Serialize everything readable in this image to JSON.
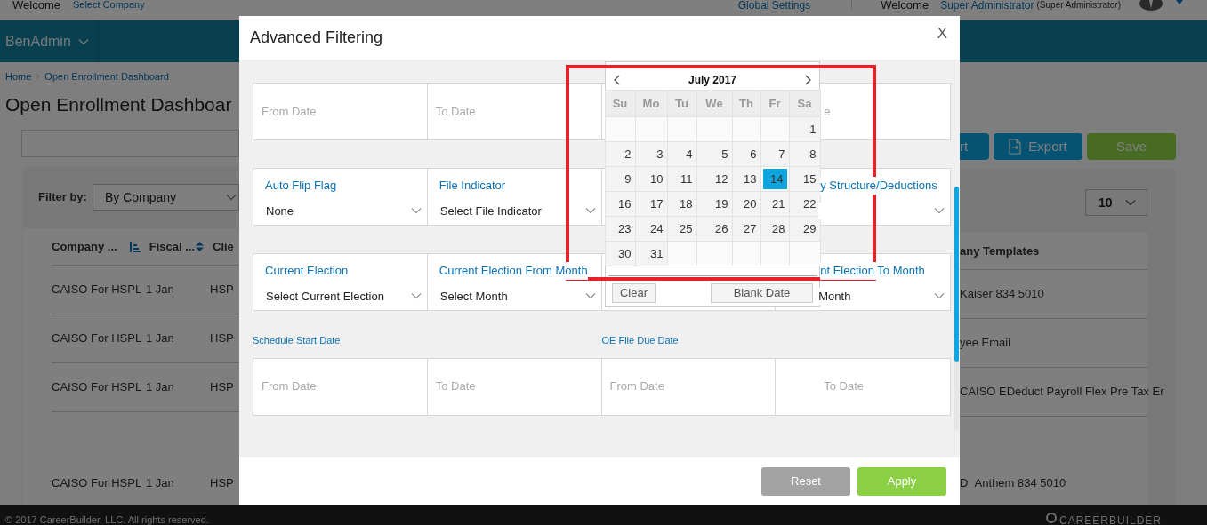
{
  "header": {
    "welcome": "Welcome",
    "company_link": "Select Company",
    "global_settings": "Global Settings",
    "user_welcome": "Welcome",
    "user_name": "Super Administrator",
    "user_role": "(Super Administrator)"
  },
  "nav": {
    "app_menu": "BenAdmin"
  },
  "breadcrumb": [
    "Home",
    "Open Enrollment Dashboard"
  ],
  "page_title": "Open Enrollment Dashboar",
  "toolbar_buttons": [
    {
      "label": "rt",
      "kind": "import"
    },
    {
      "label": "Export",
      "kind": "export"
    },
    {
      "label": "Save",
      "kind": "save"
    }
  ],
  "filter": {
    "label": "Filter by:",
    "value": "By Company"
  },
  "page_size": "10",
  "table": {
    "columns": [
      {
        "label": "Company ...",
        "kind": "list-sort"
      },
      {
        "label": "Fiscal ...",
        "kind": "updown-sort"
      },
      {
        "label": "Clie",
        "kind": "plain"
      },
      {
        "label": "any Templates",
        "kind": "plain"
      }
    ],
    "rows": [
      [
        "CAISO For HSPL",
        "1 Jan",
        "HSP",
        "Kaiser 834 5010"
      ],
      [
        "CAISO For HSPL",
        "1 Jan",
        "HSP",
        "yee Email"
      ],
      [
        "CAISO For HSPL",
        "1 Jan",
        "HSP",
        "CAISO EDeduct Payroll Flex Pre Tax Er"
      ],
      [
        "CAISO For HSPL",
        "1 Jan",
        "HSP",
        "D_Anthem 834 5010"
      ]
    ]
  },
  "dialog": {
    "title": "Advanced Filtering",
    "close": "X",
    "rows": [
      {
        "cells": [
          {
            "kind": "date",
            "placeholder": "From Date"
          },
          {
            "kind": "date",
            "placeholder": "To Date"
          },
          {
            "kind": "covered"
          },
          {
            "kind": "date",
            "placeholder": "e"
          }
        ]
      },
      {
        "cells": [
          {
            "kind": "select",
            "label": "Auto Flip Flag",
            "value": "None"
          },
          {
            "kind": "select",
            "label": "File Indicator",
            "value": "Select File Indicator"
          },
          {
            "kind": "covered"
          },
          {
            "kind": "select",
            "label": "y Structure/Deductions"
          }
        ]
      },
      {
        "cells": [
          {
            "kind": "select",
            "label": "Current Election",
            "value": "Select Current Election"
          },
          {
            "kind": "select",
            "label": "Current Election From Month",
            "value": "Select Month"
          },
          {
            "kind": "covered"
          },
          {
            "kind": "select",
            "label": "nt Election To Month",
            "value": "Month"
          }
        ]
      },
      {
        "headings": [
          "Schedule Start Date",
          "OE File Due Date"
        ],
        "cells": [
          {
            "kind": "date",
            "placeholder": "From Date"
          },
          {
            "kind": "date",
            "placeholder": "To Date"
          },
          {
            "kind": "date",
            "placeholder": "From Date"
          },
          {
            "kind": "date",
            "placeholder": "To Date"
          }
        ]
      }
    ],
    "buttons": [
      {
        "label": "Reset",
        "kind": "reset"
      },
      {
        "label": "Apply",
        "kind": "apply"
      }
    ]
  },
  "calendar": {
    "month": "July 2017",
    "weekdays": [
      "Su",
      "Mo",
      "Tu",
      "We",
      "Th",
      "Fr",
      "Sa"
    ],
    "weeks": [
      [
        {
          "kind": "blank"
        },
        {
          "kind": "blank"
        },
        {
          "kind": "blank"
        },
        {
          "kind": "blank"
        },
        {
          "kind": "blank"
        },
        {
          "kind": "blank"
        },
        {
          "kind": "day",
          "day": "1",
          "selected": false
        }
      ],
      [
        {
          "kind": "day",
          "day": "2",
          "selected": false
        },
        {
          "kind": "day",
          "day": "3",
          "selected": false
        },
        {
          "kind": "day",
          "day": "4",
          "selected": false
        },
        {
          "kind": "day",
          "day": "5",
          "selected": false
        },
        {
          "kind": "day",
          "day": "6",
          "selected": false
        },
        {
          "kind": "day",
          "day": "7",
          "selected": false
        },
        {
          "kind": "day",
          "day": "8",
          "selected": false
        }
      ],
      [
        {
          "kind": "day",
          "day": "9",
          "selected": false
        },
        {
          "kind": "day",
          "day": "10",
          "selected": false
        },
        {
          "kind": "day",
          "day": "11",
          "selected": false
        },
        {
          "kind": "day",
          "day": "12",
          "selected": false
        },
        {
          "kind": "day",
          "day": "13",
          "selected": false
        },
        {
          "kind": "day",
          "day": "14",
          "selected": true
        },
        {
          "kind": "day",
          "day": "15",
          "selected": false
        }
      ],
      [
        {
          "kind": "day",
          "day": "16",
          "selected": false
        },
        {
          "kind": "day",
          "day": "17",
          "selected": false
        },
        {
          "kind": "day",
          "day": "18",
          "selected": false
        },
        {
          "kind": "day",
          "day": "19",
          "selected": false
        },
        {
          "kind": "day",
          "day": "20",
          "selected": false
        },
        {
          "kind": "day",
          "day": "21",
          "selected": false
        },
        {
          "kind": "day",
          "day": "22",
          "selected": false
        }
      ],
      [
        {
          "kind": "day",
          "day": "23",
          "selected": false
        },
        {
          "kind": "day",
          "day": "24",
          "selected": false
        },
        {
          "kind": "day",
          "day": "25",
          "selected": false
        },
        {
          "kind": "day",
          "day": "26",
          "selected": false
        },
        {
          "kind": "day",
          "day": "27",
          "selected": false
        },
        {
          "kind": "day",
          "day": "28",
          "selected": false
        },
        {
          "kind": "day",
          "day": "29",
          "selected": false
        }
      ],
      [
        {
          "kind": "day",
          "day": "30",
          "selected": false
        },
        {
          "kind": "day",
          "day": "31",
          "selected": false
        },
        {
          "kind": "blank"
        },
        {
          "kind": "blank"
        },
        {
          "kind": "blank"
        },
        {
          "kind": "blank"
        },
        {
          "kind": "blank"
        }
      ]
    ],
    "buttons": [
      "Clear",
      "Blank Date"
    ]
  },
  "footer": {
    "copyright": "© 2017 CareerBuilder, LLC. All rights reserved.",
    "logo": "CAREERBUILDER"
  }
}
